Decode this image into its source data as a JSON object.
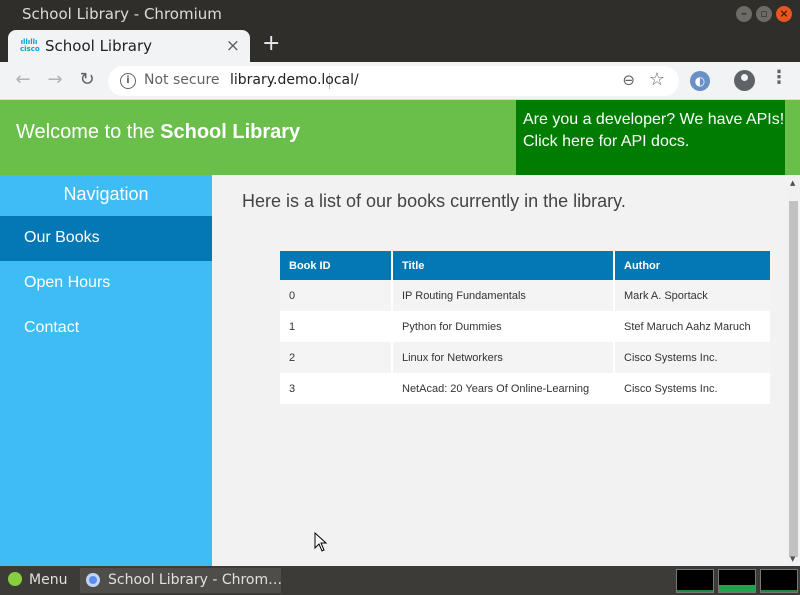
{
  "window": {
    "title": "School Library - Chromium"
  },
  "tab": {
    "title": "School Library",
    "favicon_text": "cisco",
    "close": "×",
    "new_tab": "+"
  },
  "toolbar": {
    "security_label": "Not secure",
    "url": "library.demo.local/"
  },
  "header": {
    "welcome_prefix": "Welcome to the ",
    "welcome_name": "School Library",
    "api_line1": "Are you a developer? We have APIs!",
    "api_line2": "Click here for API docs."
  },
  "sidebar": {
    "title": "Navigation",
    "items": [
      {
        "label": "Our Books",
        "active": true
      },
      {
        "label": "Open Hours",
        "active": false
      },
      {
        "label": "Contact",
        "active": false
      }
    ]
  },
  "main": {
    "intro": "Here is a list of our books currently in the library.",
    "table": {
      "headers": [
        "Book ID",
        "Title",
        "Author"
      ],
      "rows": [
        [
          "0",
          "IP Routing Fundamentals",
          "Mark A. Sportack"
        ],
        [
          "1",
          "Python for Dummies",
          "Stef Maruch Aahz Maruch"
        ],
        [
          "2",
          "Linux for Networkers",
          "Cisco Systems Inc."
        ],
        [
          "3",
          "NetAcad: 20 Years Of Online-Learning",
          "Cisco Systems Inc."
        ]
      ]
    }
  },
  "taskbar": {
    "menu_label": "Menu",
    "window_item": "School Library - Chrom…"
  },
  "icons": {
    "back": "back-arrow-icon",
    "forward": "forward-arrow-icon",
    "reload": "reload-icon",
    "info": "info-icon",
    "zoom": "zoom-out-icon",
    "star": "bookmark-star-icon",
    "profile": "profile-icon",
    "menu": "kebab-menu-icon"
  },
  "colors": {
    "header_green": "#6abf4b",
    "api_green": "#007d00",
    "sidebar_blue": "#3ebcf4",
    "active_blue": "#0378b5"
  }
}
